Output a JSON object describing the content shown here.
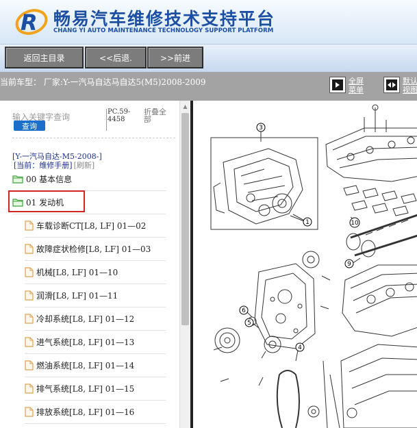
{
  "header": {
    "title_cn": "畅易汽车维修技术支持平台",
    "title_en": "CHANG YI AUTO MAINTENANCE TECHNOLOGY SUPPORT PLATFORM"
  },
  "nav": {
    "home": "返回主目录",
    "back": "<<后退.",
    "forward": ">>前进"
  },
  "vehicle_bar": {
    "current_vehicle": "当前车型：  厂家:Y-一汽马自达马自达5(M5)2008-2009",
    "fullscreen_label": "全屏\n菜单",
    "default_view_label": "默认\n视图"
  },
  "left_panel": {
    "search_hint": "输入关键字查询",
    "query_button": "查询",
    "pc_info": "PC.59-4458",
    "collapse_all": "折叠全部",
    "vehicle_link": "[Y-一汽马自达-M5-2008-]",
    "current_label": "[当前：维修手册]",
    "refresh": "[刷新]",
    "tree": [
      {
        "label": "00 基本信息",
        "type": "folder",
        "level": 0
      },
      {
        "label": "01 发动机",
        "type": "folder",
        "level": 0,
        "highlighted": true
      },
      {
        "label": "车载诊断CT[L8, LF] 01—02",
        "type": "doc",
        "level": 1
      },
      {
        "label": "故障症状检修[L8, LF] 01—03",
        "type": "doc",
        "level": 1
      },
      {
        "label": "机械[L8, LF] 01—10",
        "type": "doc",
        "level": 1
      },
      {
        "label": "润滑[L8, LF] 01—11",
        "type": "doc",
        "level": 1
      },
      {
        "label": "冷却系统[L8, LF] 01—12",
        "type": "doc",
        "level": 1
      },
      {
        "label": "进气系统[L8, LF] 01—13",
        "type": "doc",
        "level": 1
      },
      {
        "label": "燃油系统[L8, LF] 01—14",
        "type": "doc",
        "level": 1
      },
      {
        "label": "排气系统[L8, LF] 01—15",
        "type": "doc",
        "level": 1
      },
      {
        "label": "排放系统[L8, LF] 01—16",
        "type": "doc",
        "level": 1
      }
    ]
  },
  "diagram": {
    "callouts": [
      "3",
      "1",
      "10",
      "9",
      "6",
      "5",
      "4"
    ]
  },
  "colors": {
    "brand_blue": "#1c4fa3",
    "highlight_red": "#d32222",
    "folder_green": "#3aa43a",
    "doc_orange": "#e0a050"
  }
}
